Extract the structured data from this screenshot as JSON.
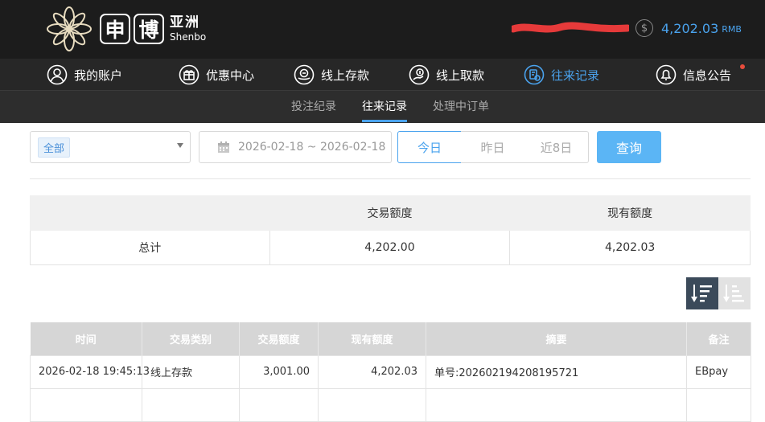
{
  "header": {
    "logo": {
      "char1": "申",
      "char2": "博",
      "cn": "亚洲",
      "en": "Shenbo"
    },
    "balance": {
      "amount": "4,202.03",
      "unit": "RMB"
    }
  },
  "main_nav": [
    {
      "label": "我的账户",
      "icon": "user-icon"
    },
    {
      "label": "优惠中心",
      "icon": "gift-icon"
    },
    {
      "label": "线上存款",
      "icon": "deposit-icon"
    },
    {
      "label": "线上取款",
      "icon": "withdraw-icon"
    },
    {
      "label": "往来记录",
      "icon": "records-icon",
      "active": true
    },
    {
      "label": "信息公告",
      "icon": "bell-icon"
    }
  ],
  "sub_nav": [
    {
      "label": "投注纪录"
    },
    {
      "label": "往来记录",
      "active": true
    },
    {
      "label": "处理中订单"
    }
  ],
  "filters": {
    "type_select": "全部",
    "date_range": "2026-02-18 ~ 2026-02-18",
    "quick_ranges": [
      "今日",
      "昨日",
      "近8日"
    ],
    "query_label": "查询"
  },
  "summary": {
    "headers": [
      "",
      "交易额度",
      "现有额度"
    ],
    "row": [
      "总计",
      "4,202.00",
      "4,202.03"
    ]
  },
  "records": {
    "headers": [
      "时间",
      "交易类别",
      "交易额度",
      "现有额度",
      "摘要",
      "备注"
    ],
    "rows": [
      [
        "2026-02-18 19:45:13",
        "线上存款",
        "3,001.00",
        "4,202.03",
        "单号:202602194208195721",
        "EBpay"
      ]
    ]
  },
  "colors": {
    "accent": "#4aa3ee",
    "header_bg": "#1c1c1c",
    "nav_bg": "#272727",
    "button": "#5bb5f5"
  }
}
